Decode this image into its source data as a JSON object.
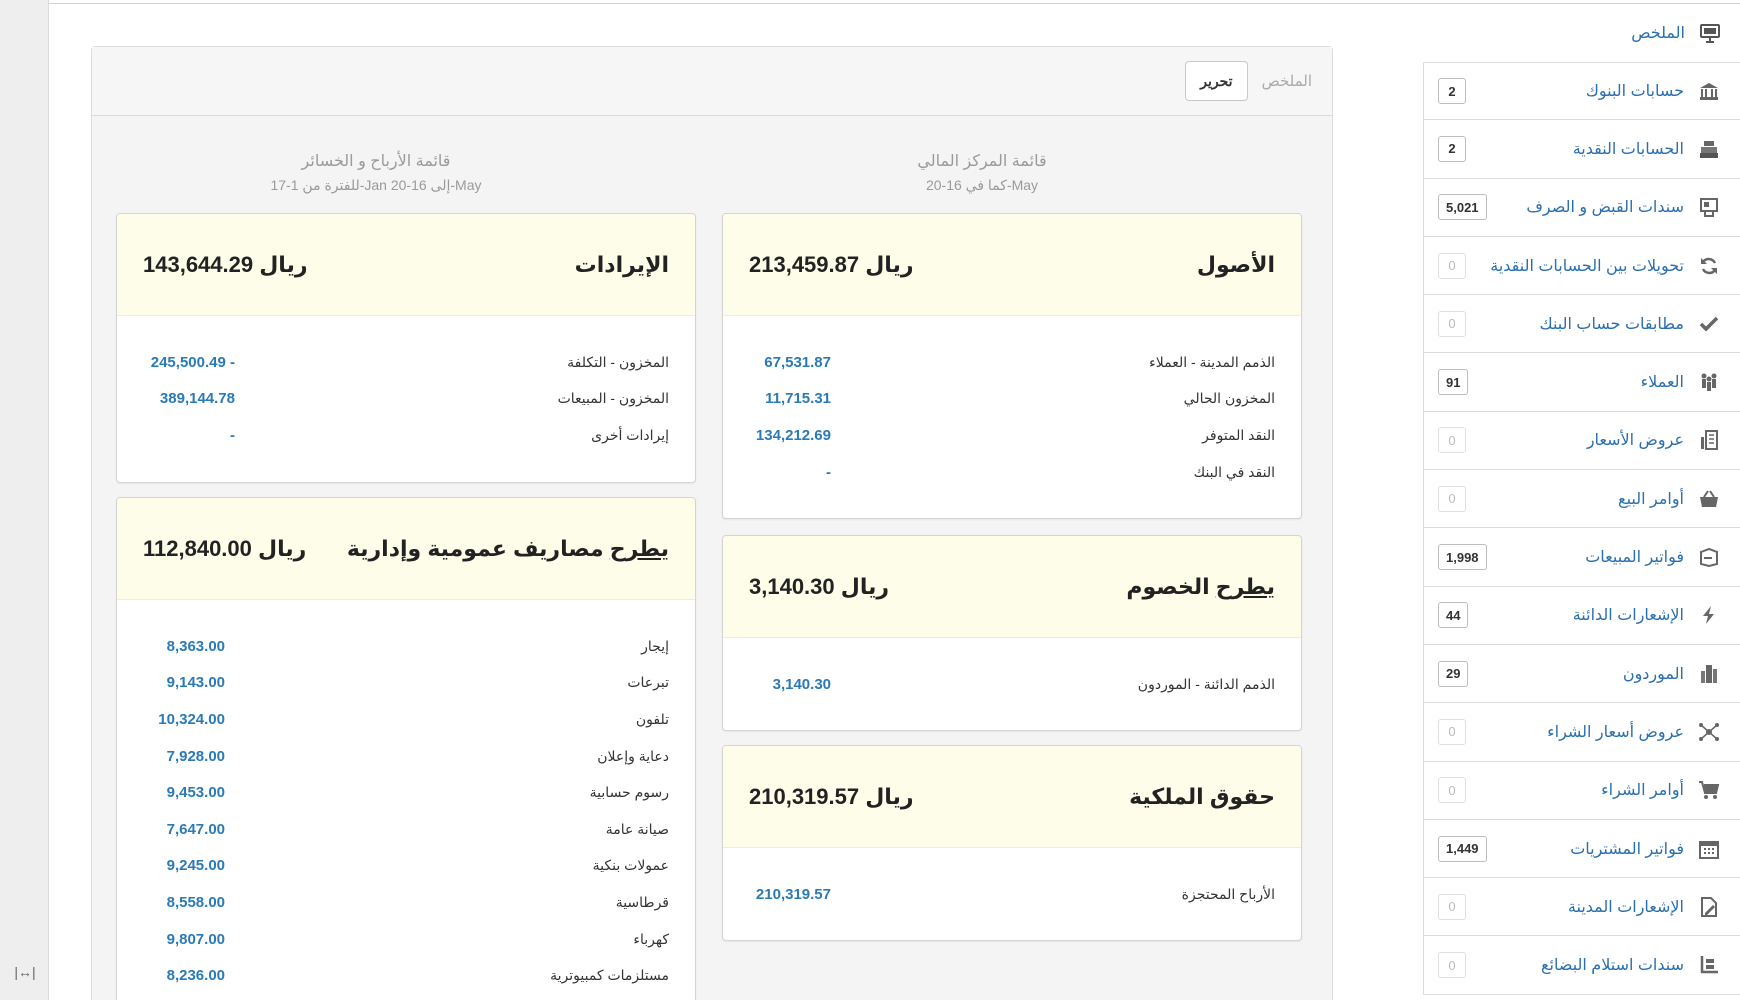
{
  "sidebar": {
    "summary_label": "الملخص",
    "items": [
      {
        "label": "حسابات البنوك",
        "badge": "2"
      },
      {
        "label": "الحسابات النقدية",
        "badge": "2"
      },
      {
        "label": "سندات القبض و الصرف",
        "badge": "5,021"
      },
      {
        "label": "تحويلات بين الحسابات النقدية",
        "badge": "0"
      },
      {
        "label": "مطابقات حساب البنك",
        "badge": "0"
      },
      {
        "label": "العملاء",
        "badge": "91"
      },
      {
        "label": "عروض الأسعار",
        "badge": "0"
      },
      {
        "label": "أوامر البيع",
        "badge": "0"
      },
      {
        "label": "فواتير المبيعات",
        "badge": "1,998"
      },
      {
        "label": "الإشعارات الدائنة",
        "badge": "44"
      },
      {
        "label": "الموردون",
        "badge": "29"
      },
      {
        "label": "عروض أسعار الشراء",
        "badge": "0"
      },
      {
        "label": "أوامر الشراء",
        "badge": "0"
      },
      {
        "label": "فواتير المشتريات",
        "badge": "1,449"
      },
      {
        "label": "الإشعارات المدينة",
        "badge": "0"
      },
      {
        "label": "سندات استلام البضائع",
        "badge": "0"
      }
    ]
  },
  "header": {
    "title": "الملخص",
    "edit_label": "تحرير"
  },
  "balance_sheet": {
    "title": "قائمة المركز المالي",
    "subtitle": "كما في 16-20-May",
    "assets": {
      "title": "الأصول",
      "total": "ريال 213,459.87",
      "rows": [
        {
          "label": "الذمم المدينة - العملاء",
          "value": "67,531.87"
        },
        {
          "label": "المخزون الحالي",
          "value": "11,715.31"
        },
        {
          "label": "النقد المتوفر",
          "value": "134,212.69"
        },
        {
          "label": "النقد في البنك",
          "value": "-"
        }
      ]
    },
    "liabilities": {
      "title_prefix": "يطرح",
      "title_rest": " الخصوم",
      "total": "ريال 3,140.30",
      "rows": [
        {
          "label": "الذمم الدائنة - الموردون",
          "value": "3,140.30"
        }
      ]
    },
    "equity": {
      "title": "حقوق الملكية",
      "total": "ريال 210,319.57",
      "rows": [
        {
          "label": "الأرباح المحتجزة",
          "value": "210,319.57"
        }
      ]
    }
  },
  "profit_loss": {
    "title": "قائمة الأرباح و الخسائر",
    "subtitle": "للفترة من 1-17-Jan إلى 16-20-May",
    "revenue": {
      "title": "الإيرادات",
      "total": "ريال 143,644.29",
      "rows": [
        {
          "label": "المخزون - التكلفة",
          "value": "245,500.49 -"
        },
        {
          "label": "المخزون - المبيعات",
          "value": "389,144.78"
        },
        {
          "label": "إيرادات أخرى",
          "value": "-"
        }
      ]
    },
    "expenses": {
      "title_prefix": "يطرح",
      "title_rest": " مصاريف عمومية وإدارية",
      "total": "ريال 112,840.00",
      "rows": [
        {
          "label": "إيجار",
          "value": "8,363.00"
        },
        {
          "label": "تبرعات",
          "value": "9,143.00"
        },
        {
          "label": "تلفون",
          "value": "10,324.00"
        },
        {
          "label": "دعاية وإعلان",
          "value": "7,928.00"
        },
        {
          "label": "رسوم حسابية",
          "value": "9,453.00"
        },
        {
          "label": "صيانة عامة",
          "value": "7,647.00"
        },
        {
          "label": "عمولات بنكية",
          "value": "9,245.00"
        },
        {
          "label": "قرطاسية",
          "value": "8,558.00"
        },
        {
          "label": "كهرباء",
          "value": "9,807.00"
        },
        {
          "label": "مستلزمات كمبيوترية",
          "value": "8,236.00"
        }
      ]
    }
  }
}
